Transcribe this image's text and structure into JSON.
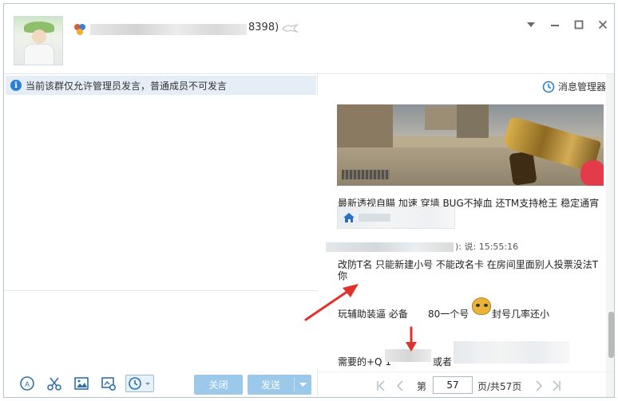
{
  "header": {
    "title_suffix": "8398)",
    "window_controls": [
      "chevron-down-icon",
      "minimize-icon",
      "maximize-icon",
      "close-icon"
    ]
  },
  "notice": {
    "text": "当前该群仅允许管理员发言，普通成员不可发言"
  },
  "toolbar": {
    "close_label": "关闭",
    "send_label": "发送"
  },
  "right": {
    "message_manager": "消息管理器",
    "line1": "最新透视自瞄 加速 穿墙 BUG不掉血  还TM支持枪王 稳定通宵",
    "sender_time": "): 说: 15:55:16",
    "line2": "改防T名 只能新建小号 不能改名卡 在房间里面别人投票没法T",
    "line3": "你",
    "line4a": "玩辅助装逼 必备",
    "line4b": "80一个号",
    "line4c": "封号几率还小",
    "line5a": "需要的+Q 1",
    "line5b": "或者"
  },
  "pager": {
    "page_prefix": "第",
    "current_page": "57",
    "page_suffix": "页/共57页"
  },
  "colors": {
    "accent": "#9cc8ea",
    "notice_bg": "#e5eef6",
    "arrow": "#e0322b"
  }
}
